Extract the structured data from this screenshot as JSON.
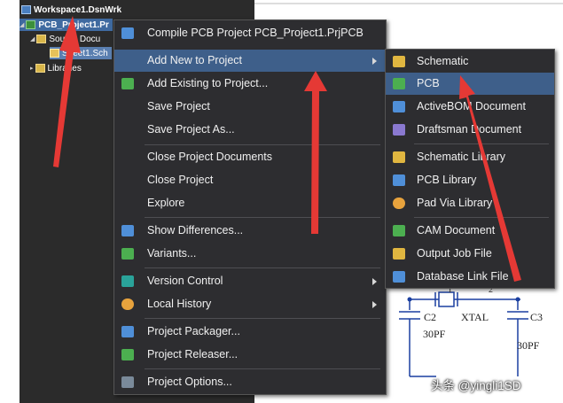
{
  "project_tree": {
    "workspace": "Workspace1.DsnWrk",
    "project": "PCB_Project1.Pr",
    "source_folder": "Source Docu",
    "sheet": "Sheet1.Sch",
    "libraries": "Libraries"
  },
  "context_menu": {
    "items": [
      {
        "label": "Compile PCB Project PCB_Project1.PrjPCB",
        "icon": "compile-icon"
      },
      {
        "label": "Add New to Project",
        "icon": "",
        "submenu": true,
        "highlighted": true
      },
      {
        "label": "Add Existing to Project...",
        "icon": "add-existing-icon"
      },
      {
        "label": "Save Project"
      },
      {
        "label": "Save Project As..."
      },
      {
        "label": "Close Project Documents"
      },
      {
        "label": "Close Project"
      },
      {
        "label": "Explore"
      },
      {
        "label": "Show Differences...",
        "icon": "differences-icon"
      },
      {
        "label": "Variants...",
        "icon": "variants-icon"
      },
      {
        "label": "Version Control",
        "icon": "version-control-icon",
        "submenu": true
      },
      {
        "label": "Local History",
        "icon": "history-icon",
        "submenu": true
      },
      {
        "label": "Project Packager...",
        "icon": "packager-icon"
      },
      {
        "label": "Project Releaser...",
        "icon": "releaser-icon"
      },
      {
        "label": "Project Options...",
        "icon": "options-icon"
      }
    ]
  },
  "submenu": {
    "items": [
      {
        "label": "Schematic",
        "icon": "schematic-icon"
      },
      {
        "label": "PCB",
        "icon": "pcb-icon",
        "highlighted": true
      },
      {
        "label": "ActiveBOM Document",
        "icon": "activebom-icon"
      },
      {
        "label": "Draftsman Document",
        "icon": "draftsman-icon"
      },
      {
        "label": "Schematic Library",
        "icon": "schematic-library-icon"
      },
      {
        "label": "PCB Library",
        "icon": "pcb-library-icon"
      },
      {
        "label": "Pad Via Library",
        "icon": "pad-via-library-icon"
      },
      {
        "label": "CAM Document",
        "icon": "cam-document-icon"
      },
      {
        "label": "Output Job File",
        "icon": "output-job-icon"
      },
      {
        "label": "Database Link File",
        "icon": "database-link-icon"
      }
    ]
  },
  "schematic": {
    "pin1": "1",
    "pin2": "2",
    "c2": "C2",
    "c2_value": "30PF",
    "xtal": "XTAL",
    "c3": "C3",
    "c3_value": "30PF"
  },
  "watermark": "头条 @yingli1SD",
  "colors": {
    "menu_bg": "#2d2d30",
    "highlight": "#3e5f8a",
    "arrow": "#e53935",
    "schematic_line": "#1a3fa0"
  }
}
